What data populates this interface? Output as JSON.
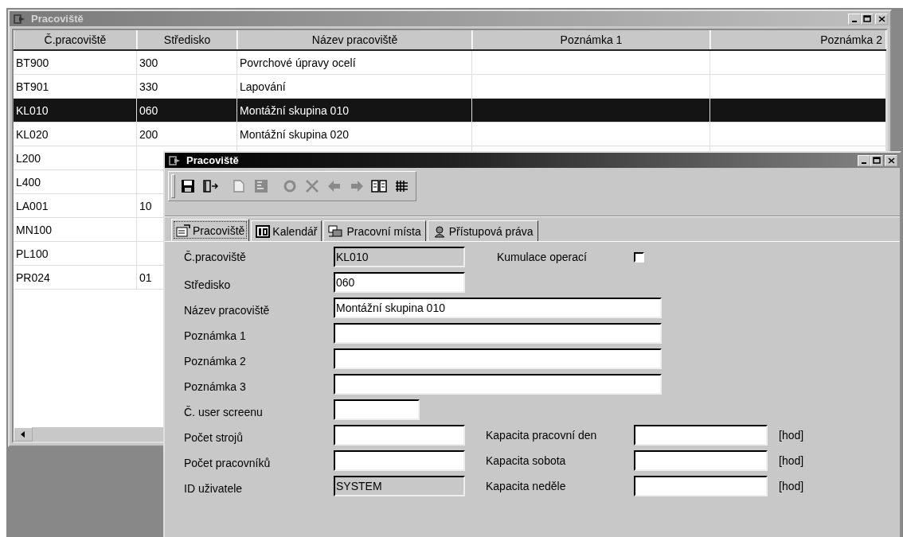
{
  "list_window": {
    "title": "Pracoviště",
    "active": false,
    "columns": [
      "Č.pracoviště",
      "Středisko",
      "Název pracoviště",
      "Poznámka 1",
      "Poznámka 2"
    ],
    "rows": [
      {
        "cells": [
          "BT900",
          "300",
          "Povrchové úpravy ocelí"
        ],
        "selected": false
      },
      {
        "cells": [
          "BT901",
          "330",
          "Lapování"
        ],
        "selected": false
      },
      {
        "cells": [
          "KL010",
          "060",
          "Montážní skupina 010"
        ],
        "selected": true
      },
      {
        "cells": [
          "KL020",
          "200",
          "Montážní skupina 020"
        ],
        "selected": false
      },
      {
        "cells": [
          "L200"
        ],
        "selected": false
      },
      {
        "cells": [
          "L400"
        ],
        "selected": false
      },
      {
        "cells": [
          "LA001",
          "10"
        ],
        "selected": false
      },
      {
        "cells": [
          "MN100"
        ],
        "selected": false
      },
      {
        "cells": [
          "PL100"
        ],
        "selected": false
      },
      {
        "cells": [
          "PR024",
          "01"
        ],
        "selected": false
      }
    ]
  },
  "detail_window": {
    "title": "Pracoviště",
    "active": true,
    "toolbar": [
      {
        "kind": "save",
        "disabled": false
      },
      {
        "kind": "exit",
        "disabled": false
      },
      {
        "kind": "new",
        "disabled": true
      },
      {
        "kind": "edit",
        "disabled": true
      },
      {
        "kind": "refresh",
        "disabled": true
      },
      {
        "kind": "delete",
        "disabled": true
      },
      {
        "kind": "prev",
        "disabled": true
      },
      {
        "kind": "next",
        "disabled": true
      },
      {
        "kind": "columns",
        "disabled": false
      },
      {
        "kind": "grid",
        "disabled": false
      }
    ],
    "tabs": [
      {
        "label": "Pracoviště",
        "selected": true
      },
      {
        "label": "Kalendář",
        "selected": false
      },
      {
        "label": "Pracovní místa",
        "selected": false
      },
      {
        "label": "Přístupová práva",
        "selected": false
      }
    ],
    "form": [
      {
        "label": "Č.pracoviště",
        "value": "KL010",
        "disabled": true,
        "extra": {
          "kind": "checkbox",
          "label": "Kumulace operací",
          "checked": false
        }
      },
      {
        "label": "Středisko",
        "value": "060",
        "disabled": false
      },
      {
        "label": "Název pracoviště",
        "value": "Montážní skupina 010",
        "disabled": false
      },
      {
        "label": "Poznámka 1",
        "disabled": false
      },
      {
        "label": "Poznámka 2",
        "disabled": false
      },
      {
        "label": "Poznámka 3",
        "disabled": false
      },
      {
        "label": "Č. user screenu",
        "disabled": false
      },
      {
        "label": "Počet strojů",
        "disabled": false,
        "extra": {
          "kind": "field",
          "label": "Kapacita pracovní den",
          "unit": "[hod]"
        }
      },
      {
        "label": "Počet pracovníků",
        "disabled": false,
        "extra": {
          "kind": "field",
          "label": "Kapacita sobota",
          "unit": "[hod]"
        }
      },
      {
        "label": "ID uživatele",
        "value": "SYSTEM",
        "disabled": true,
        "extra": {
          "kind": "field",
          "label": "Kapacita neděle",
          "unit": "[hod]"
        }
      }
    ]
  }
}
